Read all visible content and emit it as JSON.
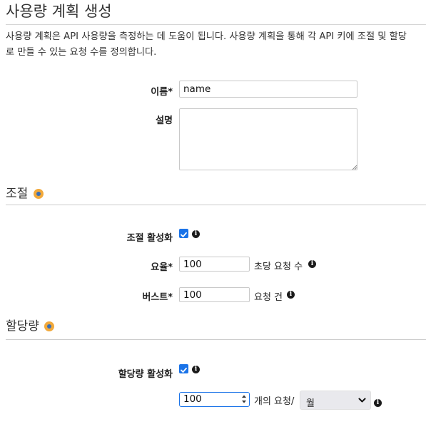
{
  "page": {
    "title": "사용량 계획 생성",
    "description_line1": "사용량 계획은 API 사용량을 측정하는 데 도움이 됩니다. 사용량 계획을 통해 각 API 키에 조절 및 할당",
    "description_line2": "로 만들 수 있는 요청 수를 정의합니다."
  },
  "form": {
    "name_label": "이름*",
    "name_value": "name",
    "description_label": "설명",
    "description_value": ""
  },
  "throttling": {
    "section_title": "조절",
    "enable_label": "조절 활성화",
    "enable_checked": true,
    "rate_label": "요율*",
    "rate_value": "100",
    "rate_unit": "초당 요청 수",
    "burst_label": "버스트*",
    "burst_value": "100",
    "burst_unit": "요청 건"
  },
  "quota": {
    "section_title": "할당량",
    "enable_label": "할당량 활성화",
    "enable_checked": true,
    "requests_value": "100",
    "requests_unit": "개의 요청/",
    "period_selected": "월"
  },
  "icons": {
    "info": "info-circle-icon",
    "help": "help-dot-icon",
    "checkbox": "checkbox-checked-icon",
    "dropdown": "chevron-down-icon",
    "spinner": "spinner-arrows-icon"
  },
  "colors": {
    "checkbox": "#1a73e8",
    "help_dot": "#f2a93b",
    "help_dot_center": "#3a6fb6",
    "focus_border": "#1a73e8"
  }
}
